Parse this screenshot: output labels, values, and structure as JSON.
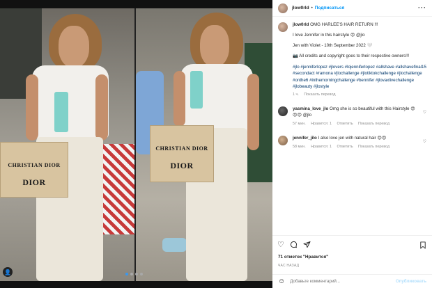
{
  "post": {
    "username": "jlow0rld",
    "follow_label": "Подписаться",
    "separator": "•",
    "more_icon": "more-horizontal-icon",
    "caption_lines": [
      "OMG HARLEE'S HAIR RETURN !!!",
      "I love Jennifer in this hairstyle 😍 @jlo",
      "Jen with Violet - 10th September 2022 🤍",
      "📷 All credits and copyright goes to their respective owners!!!"
    ],
    "hashtags": "#jlo #jenniferlopez #jlovers #lojenniferlopez #allshave #allshavefinal15 #secondact #ramona #jlochallenge #jlotiktokchallenge #jlochallenge #onthe6 #inthemorningchallenge #bennifer #jlovaxlivechallenge #jlobeauty #jlostyle",
    "caption_meta": {
      "time": "1 ч.",
      "translate": "Показать перевод"
    }
  },
  "comments": [
    {
      "username": "yasmina_love_jlo",
      "text": "Omg she is so beautiful with this Hairstyle 😍😍😍 @jlo",
      "time": "57 мин.",
      "likes": "Нравится: 1",
      "reply": "Ответить",
      "translate": "Показать перевод"
    },
    {
      "username": "jennifer_jilo",
      "text": "I also love jen with natural hair 😍😍",
      "time": "58 мин.",
      "likes": "Нравится: 1",
      "reply": "Ответить",
      "translate": "Показать перевод"
    }
  ],
  "media": {
    "bag_text_top": "CHRISTIAN DIOR",
    "bag_text_bottom": "DIOR",
    "carousel_dots": 4,
    "active_dot": 0
  },
  "actions": {
    "like_icon": "heart-icon",
    "comment_icon": "comment-icon",
    "share_icon": "share-icon",
    "save_icon": "bookmark-icon"
  },
  "likes_text": "71 отметок \"Нравится\"",
  "time_text": "час назад",
  "comment_box": {
    "placeholder": "Добавьте комментарий...",
    "publish_label": "Опубликовать",
    "emoji_icon": "emoji-icon"
  },
  "colors": {
    "accent": "#0095f6",
    "hashtag": "#00376b",
    "muted": "#8e8e8e"
  }
}
